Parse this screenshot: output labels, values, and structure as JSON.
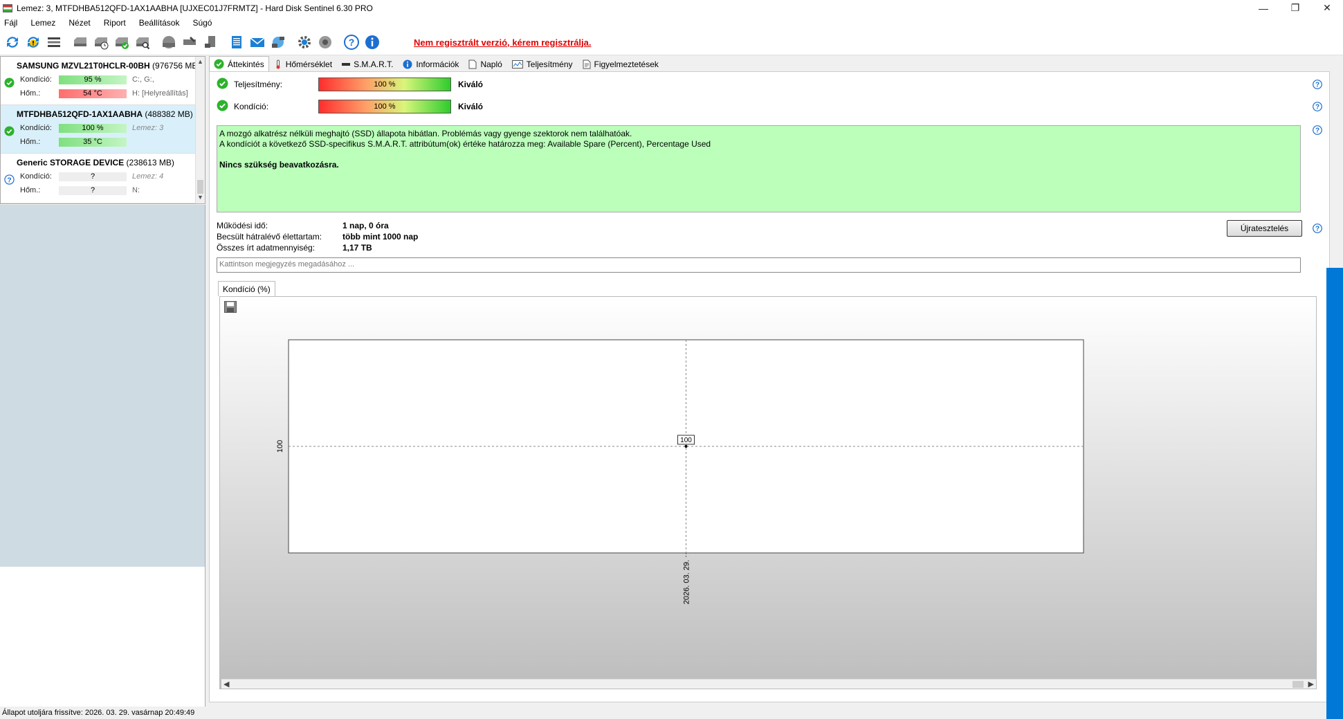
{
  "window": {
    "title": "Lemez: 3, MTFDHBA512QFD-1AX1AABHA [UJXEC01J7FRMTZ]  -  Hard Disk Sentinel 6.30 PRO",
    "controls": [
      "—",
      "❐",
      "✕"
    ]
  },
  "menu": [
    "Fájl",
    "Lemez",
    "Nézet",
    "Riport",
    "Beállítások",
    "Súgó"
  ],
  "toolbar": {
    "icons": [
      "refresh-icon",
      "refresh-warning-icon",
      "drive-list-icon",
      "disk-gray-icon",
      "disk-clock-icon",
      "disk-check-icon",
      "disk-search-icon",
      "hdd-gray-icon",
      "drive-tools-icon",
      "disk-tools-icon",
      "notepad-icon",
      "email-icon",
      "network-icon",
      "settings-gear-icon",
      "sound-icon",
      "help-icon",
      "info-icon"
    ],
    "registration_warning": "Nem regisztrált verzió, kérem regisztrálja."
  },
  "drives": [
    {
      "name": "SAMSUNG MZVL21T0HCLR-00BH",
      "size": "(976756 MB",
      "status": "ok",
      "condition_label": "Kondíció:",
      "condition_value": "95 %",
      "condition_color": "green",
      "condition_extra": "C:, G:,",
      "temp_label": "Hőm.:",
      "temp_value": "54 °C",
      "temp_color": "red",
      "temp_extra": "H: [Helyreállítás]",
      "selected": false
    },
    {
      "name": "MTFDHBA512QFD-1AX1AABHA",
      "size": "(488382 MB)",
      "status": "ok",
      "condition_label": "Kondíció:",
      "condition_value": "100 %",
      "condition_color": "green",
      "condition_extra": "Lemez: 3",
      "temp_label": "Hőm.:",
      "temp_value": "35 °C",
      "temp_color": "green",
      "temp_extra": "",
      "selected": true
    },
    {
      "name": "Generic STORAGE DEVICE",
      "size": "(238613 MB)",
      "status": "unknown",
      "condition_label": "Kondíció:",
      "condition_value": "?",
      "condition_color": "gray",
      "condition_extra": "Lemez: 4",
      "temp_label": "Hőm.:",
      "temp_value": "?",
      "temp_color": "gray",
      "temp_extra": "N:",
      "selected": false
    }
  ],
  "tabs": [
    "Áttekintés",
    "Hőmérséklet",
    "S.M.A.R.T.",
    "Információk",
    "Napló",
    "Teljesítmény",
    "Figyelmeztetések"
  ],
  "overview": {
    "performance_label": "Teljesítmény:",
    "performance_value": "100 %",
    "performance_percent": 100,
    "performance_rating": "Kiváló",
    "health_label": "Kondíció:",
    "health_value": "100 %",
    "health_percent": 100,
    "health_rating": "Kiváló",
    "info_line1": "A mozgó alkatrész nélküli meghajtó (SSD) állapota hibátlan. Problémás vagy gyenge szektorok nem találhatóak.",
    "info_line2": "A kondíciót a következő SSD-specifikus S.M.A.R.T. attribútum(ok) értéke határozza meg:  Available Spare (Percent), Percentage Used",
    "info_bold": "Nincs szükség beavatkozásra.",
    "power_on_label": "Működési idő:",
    "power_on_value": "1 nap, 0 óra",
    "lifetime_label": "Becsült hátralévő élettartam:",
    "lifetime_value": "több mint 1000 nap",
    "written_label": "Összes írt adatmennyiség:",
    "written_value": "1,17 TB",
    "retest_label": "Újratesztelés",
    "note_placeholder": "Kattintson megjegyzés megadásához ..."
  },
  "chart_tab_label": "Kondíció  (%)",
  "chart_data": {
    "type": "line",
    "x": [
      "2026. 03. 29."
    ],
    "series": [
      {
        "values": [
          100
        ]
      }
    ],
    "ytick_labels": [
      "100"
    ],
    "xtick_labels": [
      "2026. 03. 29."
    ],
    "data_labels": [
      "100"
    ],
    "grid": true
  },
  "statusbar": "Állapot utoljára frissítve: 2026. 03. 29. vasárnap 20:49:49",
  "colors": {
    "registration_warning": "#e00000",
    "info_box": "#bbffbb",
    "selected_drive": "#d9f0fb",
    "ok_green": "#2db22d",
    "unknown_blue": "#1c6fd1"
  }
}
